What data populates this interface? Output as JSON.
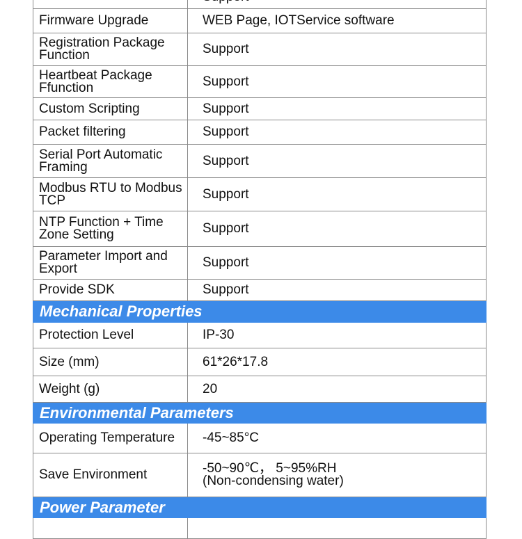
{
  "top_partial_value": "Support",
  "rows_a": [
    {
      "k": "Firmware Upgrade",
      "v": "WEB Page, IOTService software"
    },
    {
      "k": "Registration Package Function",
      "v": "Support"
    },
    {
      "k": "Heartbeat Package Ffunction",
      "v": "Support"
    },
    {
      "k": "Custom Scripting",
      "v": "Support"
    },
    {
      "k": "Packet filtering",
      "v": "Support"
    },
    {
      "k": "Serial Port Automatic Framing",
      "v": "Support"
    },
    {
      "k": "Modbus RTU to Modbus TCP",
      "v": "Support"
    },
    {
      "k": "NTP Function + Time Zone Setting",
      "v": "Support"
    },
    {
      "k": "Parameter Import and Export",
      "v": "Support"
    },
    {
      "k": "Provide SDK",
      "v": "Support"
    }
  ],
  "mechanical": {
    "title": "Mechanical Properties",
    "rows": [
      {
        "k": "Protection Level",
        "v": "IP-30"
      },
      {
        "k": "Size (mm)",
        "v": "61*26*17.8"
      },
      {
        "k": "Weight (g)",
        "v": "20"
      }
    ]
  },
  "environmental": {
    "title": "Environmental Parameters",
    "rows": [
      {
        "k": "Operating Temperature",
        "v": "-45~85°C"
      },
      {
        "k": "Save Environment",
        "v": "-50~90℃， 5~95%RH",
        "v2": "(Non-condensing water)"
      }
    ]
  },
  "power": {
    "title": "Power Parameter"
  },
  "colors": {
    "header_bg": "#3c8ae8",
    "header_text": "#ffffff",
    "border": "#8a8a8a"
  }
}
